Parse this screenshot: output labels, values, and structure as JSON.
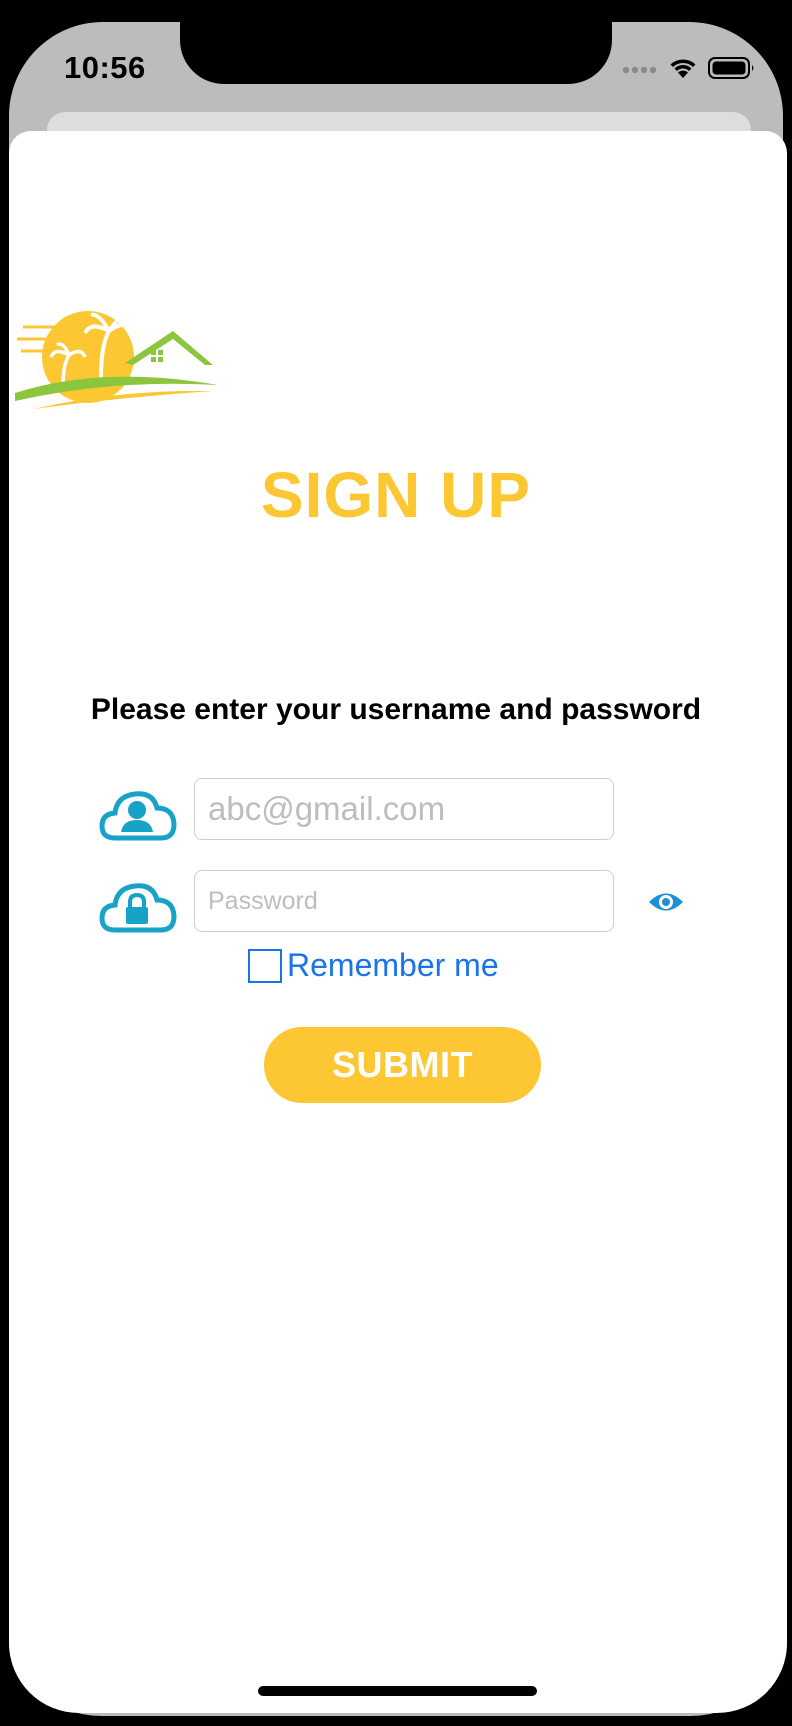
{
  "status_bar": {
    "time": "10:56",
    "icons": [
      "signal-icon",
      "wifi-icon",
      "battery-icon"
    ]
  },
  "app": {
    "logo": "beach-house-logo",
    "title": "SIGN UP",
    "subtitle": "Please enter your username and password"
  },
  "form": {
    "email_placeholder": "abc@gmail.com",
    "email_value": "",
    "password_placeholder": "Password",
    "password_value": "",
    "remember_label": "Remember me",
    "remember_checked": false,
    "submit_label": "SUBMIT"
  },
  "colors": {
    "accent": "#fcc733",
    "link_blue": "#1a73e8",
    "icon_teal": "#17a2c7",
    "logo_green": "#8cc63f"
  }
}
